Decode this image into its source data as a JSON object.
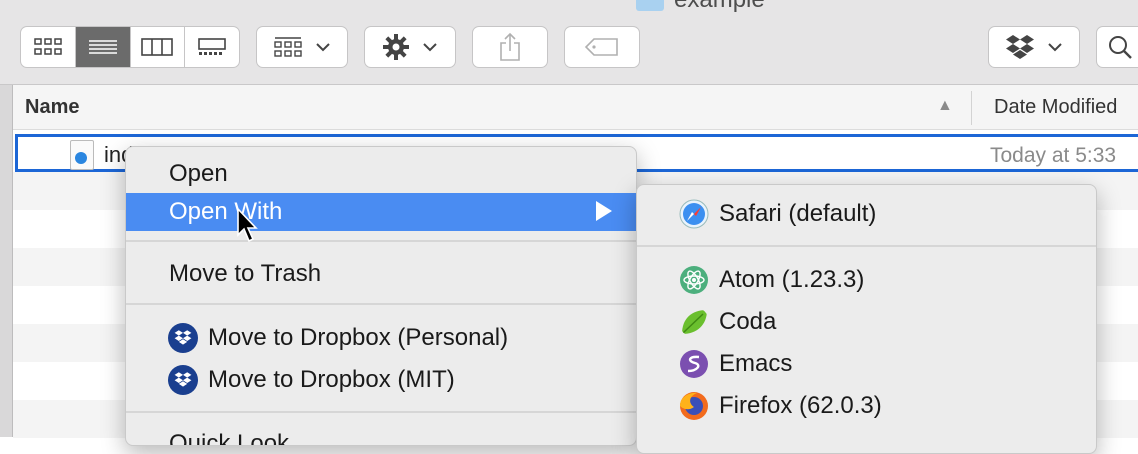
{
  "window": {
    "title": "example"
  },
  "toolbar": {
    "view_icons": [
      "icon-view-icon",
      "list-view-icon",
      "column-view-icon",
      "gallery-view-icon"
    ],
    "active_view": "list-view-icon",
    "icons": [
      "group-icon",
      "action-gear-icon",
      "share-icon",
      "tag-icon",
      "dropbox-icon",
      "search-icon"
    ]
  },
  "columns": {
    "name": "Name",
    "date_modified": "Date Modified"
  },
  "file": {
    "name": "index.html",
    "name_visible_prefix": "ind",
    "date": "Today at 5:33"
  },
  "context_menu": {
    "items": [
      {
        "label": "Open"
      },
      {
        "label": "Open With"
      },
      {
        "label": "Move to Trash"
      },
      {
        "label": "Move to Dropbox (Personal)"
      },
      {
        "label": "Move to Dropbox (MIT)"
      },
      {
        "label": "Quick Look"
      }
    ]
  },
  "open_with_menu": {
    "items": [
      {
        "label": "Safari (default)"
      },
      {
        "label": "Atom (1.23.3)"
      },
      {
        "label": "Coda"
      },
      {
        "label": "Emacs"
      },
      {
        "label": "Firefox (62.0.3)"
      }
    ]
  },
  "colors": {
    "selection": "#1c66d6",
    "highlight": "#4a8cf2",
    "dropbox": "#1a3f8f"
  }
}
